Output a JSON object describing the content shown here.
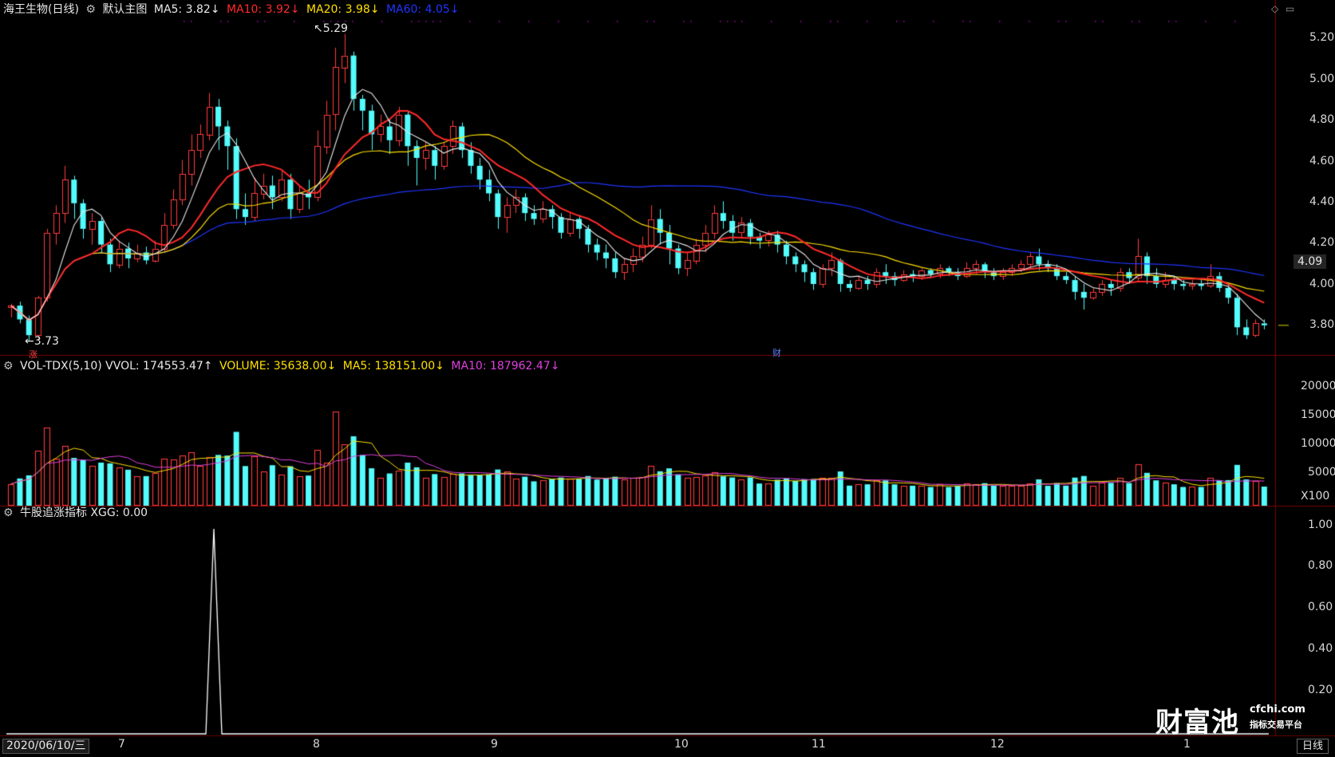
{
  "main_panel": {
    "stock_label": "海王生物(日线)",
    "template_label": "默认主图",
    "indicators": [
      {
        "text": "MA5: 3.82↓",
        "color": "#e8e8e8"
      },
      {
        "text": "MA10: 3.92↓",
        "color": "#ff2a2a"
      },
      {
        "text": "MA20: 3.98↓",
        "color": "#ffe000"
      },
      {
        "text": "MA60: 4.05↓",
        "color": "#1f35ff"
      }
    ],
    "high_label": "5.29",
    "low_label": "3.73",
    "zhang_tag": "涨",
    "cai_tag": "财",
    "current_price": "4.09",
    "y_ticks": [
      "5.20",
      "5.00",
      "4.80",
      "4.60",
      "4.40",
      "4.20",
      "4.00",
      "3.80"
    ]
  },
  "volume_panel": {
    "title": "VOL-TDX(5,10) VVOL: 174553.47↑",
    "indicators": [
      {
        "text": "VOLUME: 35638.00↓",
        "color": "#ffe000"
      },
      {
        "text": "MA5: 138151.00↓",
        "color": "#ffe000"
      },
      {
        "text": "MA10: 187962.47↓",
        "color": "#e040e0"
      }
    ],
    "y_ticks": [
      "20000",
      "15000",
      "10000",
      "5000",
      "X100"
    ]
  },
  "xgg_panel": {
    "title": "牛股追涨指标 XGG: 0.00",
    "y_ticks": [
      "1.00",
      "0.80",
      "0.60",
      "0.40",
      "0.20"
    ]
  },
  "x_axis": {
    "date_label": "2020/06/10/三",
    "months": [
      "7",
      "8",
      "9",
      "10",
      "11",
      "12",
      "1"
    ],
    "period_button": "日线"
  },
  "watermark": {
    "brand": "财富池",
    "site": "cfchi.com",
    "tagline": "指标交易平台"
  },
  "colors": {
    "up": "#ff3b3b",
    "down": "#54fcfc",
    "ma5": "#e8e8e8",
    "ma10": "#ff2a2a",
    "ma20": "#ffe000",
    "ma60": "#1f35ff",
    "vol_ma10": "#e040e0"
  },
  "chart_data": {
    "type": "candlestick",
    "y_range": [
      3.7,
      5.3
    ],
    "candles": [
      [
        3.9,
        3.91,
        3.85,
        3.92
      ],
      [
        3.91,
        3.84,
        3.82,
        3.93
      ],
      [
        3.84,
        3.76,
        3.73,
        3.86
      ],
      [
        3.76,
        3.95,
        3.74,
        3.96
      ],
      [
        3.95,
        4.28,
        3.93,
        4.3
      ],
      [
        4.28,
        4.38,
        4.22,
        4.42
      ],
      [
        4.38,
        4.55,
        4.33,
        4.62
      ],
      [
        4.55,
        4.43,
        4.35,
        4.57
      ],
      [
        4.43,
        4.3,
        4.25,
        4.45
      ],
      [
        4.3,
        4.34,
        4.22,
        4.38
      ],
      [
        4.34,
        4.22,
        4.18,
        4.36
      ],
      [
        4.22,
        4.12,
        4.08,
        4.25
      ],
      [
        4.12,
        4.2,
        4.1,
        4.24
      ],
      [
        4.2,
        4.15,
        4.1,
        4.23
      ],
      [
        4.15,
        4.18,
        4.13,
        4.22
      ],
      [
        4.18,
        4.14,
        4.12,
        4.21
      ],
      [
        4.14,
        4.2,
        4.13,
        4.24
      ],
      [
        4.2,
        4.32,
        4.18,
        4.38
      ],
      [
        4.32,
        4.45,
        4.3,
        4.5
      ],
      [
        4.45,
        4.58,
        4.42,
        4.65
      ],
      [
        4.58,
        4.7,
        4.52,
        4.78
      ],
      [
        4.7,
        4.78,
        4.66,
        4.83
      ],
      [
        4.78,
        4.92,
        4.75,
        4.99
      ],
      [
        4.92,
        4.82,
        4.7,
        4.96
      ],
      [
        4.82,
        4.72,
        4.6,
        4.85
      ],
      [
        4.72,
        4.4,
        4.35,
        4.76
      ],
      [
        4.4,
        4.36,
        4.32,
        4.48
      ],
      [
        4.36,
        4.48,
        4.34,
        4.56
      ],
      [
        4.48,
        4.52,
        4.45,
        4.58
      ],
      [
        4.52,
        4.46,
        4.4,
        4.57
      ],
      [
        4.46,
        4.55,
        4.44,
        4.6
      ],
      [
        4.55,
        4.4,
        4.35,
        4.58
      ],
      [
        4.4,
        4.48,
        4.38,
        4.52
      ],
      [
        4.48,
        4.46,
        4.4,
        4.55
      ],
      [
        4.46,
        4.72,
        4.44,
        4.8
      ],
      [
        4.72,
        4.88,
        4.68,
        4.95
      ],
      [
        4.88,
        5.12,
        4.8,
        5.22
      ],
      [
        5.12,
        5.18,
        5.04,
        5.29
      ],
      [
        5.18,
        4.96,
        4.9,
        5.2
      ],
      [
        4.96,
        4.9,
        4.8,
        4.98
      ],
      [
        4.9,
        4.78,
        4.7,
        4.93
      ],
      [
        4.78,
        4.82,
        4.74,
        4.88
      ],
      [
        4.82,
        4.75,
        4.68,
        4.86
      ],
      [
        4.75,
        4.88,
        4.72,
        4.92
      ],
      [
        4.88,
        4.72,
        4.62,
        4.9
      ],
      [
        4.72,
        4.66,
        4.52,
        4.75
      ],
      [
        4.66,
        4.7,
        4.6,
        4.74
      ],
      [
        4.7,
        4.62,
        4.55,
        4.72
      ],
      [
        4.62,
        4.72,
        4.6,
        4.74
      ],
      [
        4.72,
        4.82,
        4.68,
        4.85
      ],
      [
        4.82,
        4.7,
        4.66,
        4.84
      ],
      [
        4.7,
        4.62,
        4.58,
        4.74
      ],
      [
        4.62,
        4.55,
        4.5,
        4.66
      ],
      [
        4.55,
        4.48,
        4.44,
        4.6
      ],
      [
        4.48,
        4.36,
        4.3,
        4.5
      ],
      [
        4.36,
        4.42,
        4.28,
        4.46
      ],
      [
        4.42,
        4.46,
        4.38,
        4.5
      ],
      [
        4.46,
        4.38,
        4.34,
        4.48
      ],
      [
        4.38,
        4.35,
        4.32,
        4.42
      ],
      [
        4.35,
        4.4,
        4.33,
        4.44
      ],
      [
        4.4,
        4.36,
        4.3,
        4.42
      ],
      [
        4.36,
        4.28,
        4.25,
        4.38
      ],
      [
        4.28,
        4.35,
        4.26,
        4.38
      ],
      [
        4.35,
        4.3,
        4.25,
        4.37
      ],
      [
        4.3,
        4.22,
        4.18,
        4.32
      ],
      [
        4.22,
        4.18,
        4.14,
        4.25
      ],
      [
        4.18,
        4.15,
        4.1,
        4.22
      ],
      [
        4.15,
        4.08,
        4.05,
        4.18
      ],
      [
        4.08,
        4.12,
        4.04,
        4.15
      ],
      [
        4.12,
        4.16,
        4.08,
        4.2
      ],
      [
        4.16,
        4.22,
        4.13,
        4.26
      ],
      [
        4.22,
        4.35,
        4.2,
        4.42
      ],
      [
        4.35,
        4.28,
        4.22,
        4.4
      ],
      [
        4.28,
        4.2,
        4.12,
        4.32
      ],
      [
        4.2,
        4.1,
        4.07,
        4.22
      ],
      [
        4.1,
        4.14,
        4.06,
        4.18
      ],
      [
        4.14,
        4.22,
        4.12,
        4.25
      ],
      [
        4.22,
        4.28,
        4.18,
        4.32
      ],
      [
        4.28,
        4.38,
        4.25,
        4.42
      ],
      [
        4.38,
        4.34,
        4.3,
        4.44
      ],
      [
        4.34,
        4.28,
        4.24,
        4.37
      ],
      [
        4.28,
        4.33,
        4.25,
        4.36
      ],
      [
        4.33,
        4.26,
        4.22,
        4.35
      ],
      [
        4.26,
        4.24,
        4.2,
        4.28
      ],
      [
        4.24,
        4.27,
        4.21,
        4.29
      ],
      [
        4.27,
        4.22,
        4.18,
        4.29
      ],
      [
        4.22,
        4.16,
        4.12,
        4.24
      ],
      [
        4.16,
        4.12,
        4.08,
        4.18
      ],
      [
        4.12,
        4.08,
        4.03,
        4.14
      ],
      [
        4.08,
        4.02,
        3.99,
        4.1
      ],
      [
        4.02,
        4.1,
        4.0,
        4.12
      ],
      [
        4.1,
        4.14,
        4.06,
        4.18
      ],
      [
        4.14,
        4.02,
        3.98,
        4.15
      ],
      [
        4.02,
        4.0,
        3.98,
        4.04
      ],
      [
        4.0,
        4.04,
        3.99,
        4.06
      ],
      [
        4.04,
        4.02,
        3.99,
        4.06
      ],
      [
        4.02,
        4.08,
        4.0,
        4.1
      ],
      [
        4.08,
        4.06,
        4.02,
        4.12
      ],
      [
        4.06,
        4.04,
        4.01,
        4.08
      ],
      [
        4.04,
        4.07,
        4.03,
        4.09
      ],
      [
        4.07,
        4.06,
        4.03,
        4.09
      ],
      [
        4.06,
        4.09,
        4.04,
        4.1
      ],
      [
        4.09,
        4.07,
        4.05,
        4.1
      ],
      [
        4.07,
        4.1,
        4.05,
        4.12
      ],
      [
        4.1,
        4.08,
        4.06,
        4.11
      ],
      [
        4.08,
        4.06,
        4.04,
        4.1
      ],
      [
        4.06,
        4.1,
        4.05,
        4.13
      ],
      [
        4.1,
        4.12,
        4.07,
        4.14
      ],
      [
        4.12,
        4.08,
        4.05,
        4.13
      ],
      [
        4.08,
        4.06,
        4.04,
        4.1
      ],
      [
        4.06,
        4.08,
        4.04,
        4.1
      ],
      [
        4.08,
        4.1,
        4.06,
        4.12
      ],
      [
        4.1,
        4.12,
        4.08,
        4.14
      ],
      [
        4.12,
        4.16,
        4.1,
        4.18
      ],
      [
        4.16,
        4.12,
        4.09,
        4.2
      ],
      [
        4.12,
        4.1,
        4.08,
        4.14
      ],
      [
        4.1,
        4.06,
        4.04,
        4.12
      ],
      [
        4.06,
        4.04,
        4.02,
        4.08
      ],
      [
        4.04,
        3.98,
        3.94,
        4.06
      ],
      [
        3.98,
        3.95,
        3.89,
        4.02
      ],
      [
        3.95,
        3.98,
        3.94,
        4.0
      ],
      [
        3.98,
        4.02,
        3.96,
        4.04
      ],
      [
        4.02,
        4.0,
        3.96,
        4.04
      ],
      [
        4.0,
        4.08,
        3.98,
        4.1
      ],
      [
        4.08,
        4.05,
        4.02,
        4.1
      ],
      [
        4.05,
        4.16,
        4.03,
        4.25
      ],
      [
        4.16,
        4.06,
        4.02,
        4.18
      ],
      [
        4.06,
        4.02,
        4.0,
        4.1
      ],
      [
        4.02,
        4.04,
        4.0,
        4.08
      ],
      [
        4.04,
        4.02,
        3.99,
        4.06
      ],
      [
        4.02,
        4.01,
        3.99,
        4.04
      ],
      [
        4.01,
        4.02,
        3.99,
        4.04
      ],
      [
        4.02,
        4.01,
        3.99,
        4.04
      ],
      [
        4.01,
        4.06,
        4.0,
        4.12
      ],
      [
        4.06,
        4.0,
        3.98,
        4.08
      ],
      [
        4.0,
        3.95,
        3.92,
        4.02
      ],
      [
        3.95,
        3.8,
        3.76,
        3.97
      ],
      [
        3.8,
        3.76,
        3.74,
        3.84
      ],
      [
        3.76,
        3.82,
        3.75,
        3.84
      ],
      [
        3.82,
        3.81,
        3.79,
        3.84
      ]
    ],
    "spike_index": 29
  }
}
